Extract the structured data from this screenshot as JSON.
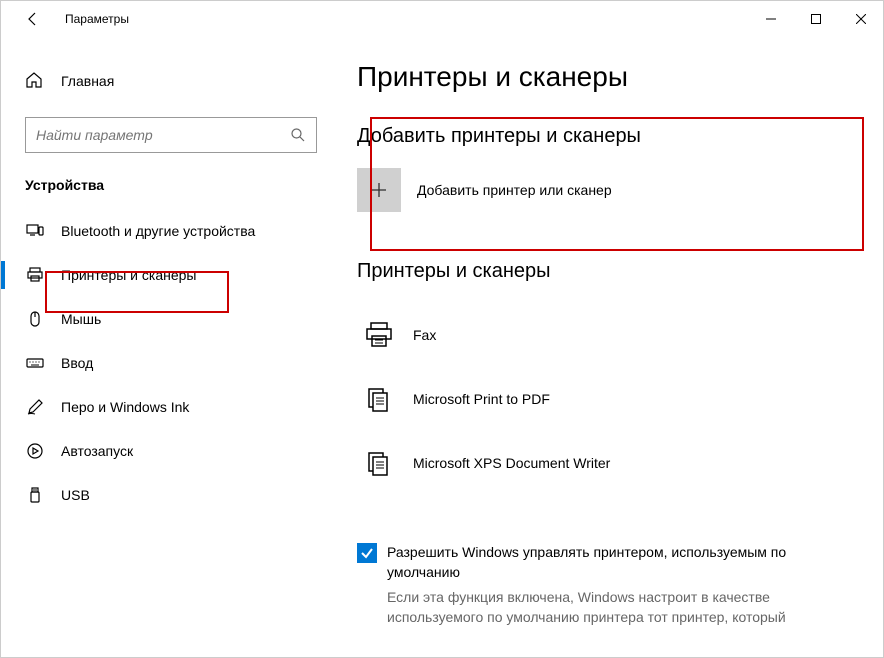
{
  "window": {
    "title": "Параметры"
  },
  "sidebar": {
    "home_label": "Главная",
    "search_placeholder": "Найти параметр",
    "section_title": "Устройства",
    "items": [
      {
        "label": "Bluetooth и другие устройства"
      },
      {
        "label": "Принтеры и сканеры"
      },
      {
        "label": "Мышь"
      },
      {
        "label": "Ввод"
      },
      {
        "label": "Перо и Windows Ink"
      },
      {
        "label": "Автозапуск"
      },
      {
        "label": "USB"
      }
    ]
  },
  "main": {
    "page_title": "Принтеры и сканеры",
    "add_section_title": "Добавить принтеры и сканеры",
    "add_label": "Добавить принтер или сканер",
    "list_section_title": "Принтеры и сканеры",
    "printers": [
      {
        "label": "Fax"
      },
      {
        "label": "Microsoft Print to PDF"
      },
      {
        "label": "Microsoft XPS Document Writer"
      }
    ],
    "default_checkbox_label": "Разрешить Windows управлять принтером, используемым по умолчанию",
    "default_hint": "Если эта функция включена, Windows настроит в качестве используемого по умолчанию принтера тот принтер, который"
  }
}
